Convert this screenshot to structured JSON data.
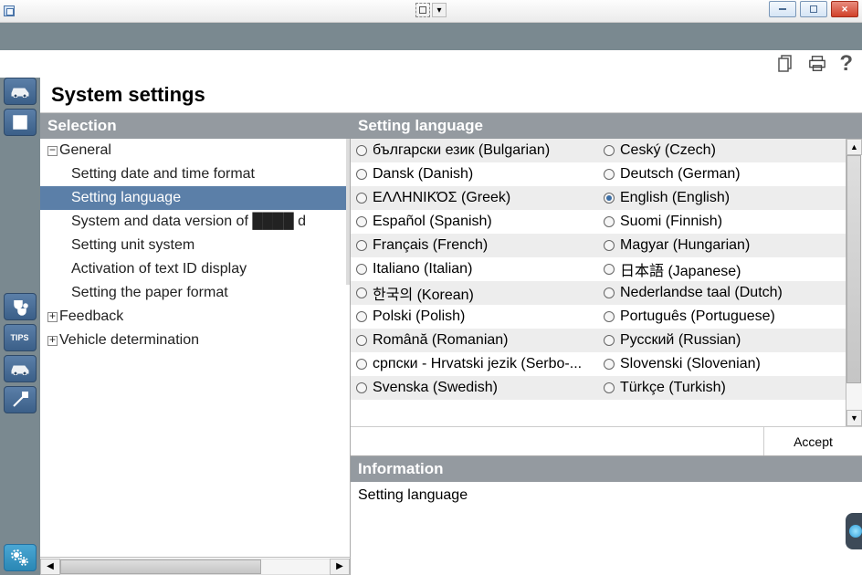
{
  "page_title": "System settings",
  "col_headers": {
    "left": "Selection",
    "right": "Setting language"
  },
  "tree": {
    "general": "General",
    "children": {
      "dt": "Setting date and time format",
      "lang": "Setting language",
      "ver": "System and data version of ████ d",
      "unit": "Setting unit system",
      "textid": "Activation of text ID display",
      "paper": "Setting the paper format"
    },
    "feedback": "Feedback",
    "vehicle": "Vehicle determination"
  },
  "languages_left": [
    "български език (Bulgarian)",
    "Dansk (Danish)",
    "ΕΛΛΗΝΙΚΌΣ (Greek)",
    "Español (Spanish)",
    "Français (French)",
    "Italiano (Italian)",
    "한국의 (Korean)",
    "Polski (Polish)",
    "Română (Romanian)",
    "српски - Hrvatski jezik (Serbo-...",
    "Svenska (Swedish)"
  ],
  "languages_right": [
    "Ceský (Czech)",
    "Deutsch (German)",
    "English (English)",
    "Suomi (Finnish)",
    "Magyar (Hungarian)",
    "日本語 (Japanese)",
    "Nederlandse taal (Dutch)",
    "Português (Portuguese)",
    "Русский (Russian)",
    "Slovenski (Slovenian)",
    "Türkçe (Turkish)"
  ],
  "selected_language": "English (English)",
  "accept_label": "Accept",
  "info_header": "Information",
  "info_body": "Setting language",
  "sidebar_tips": "TIPS",
  "help_label": "?"
}
